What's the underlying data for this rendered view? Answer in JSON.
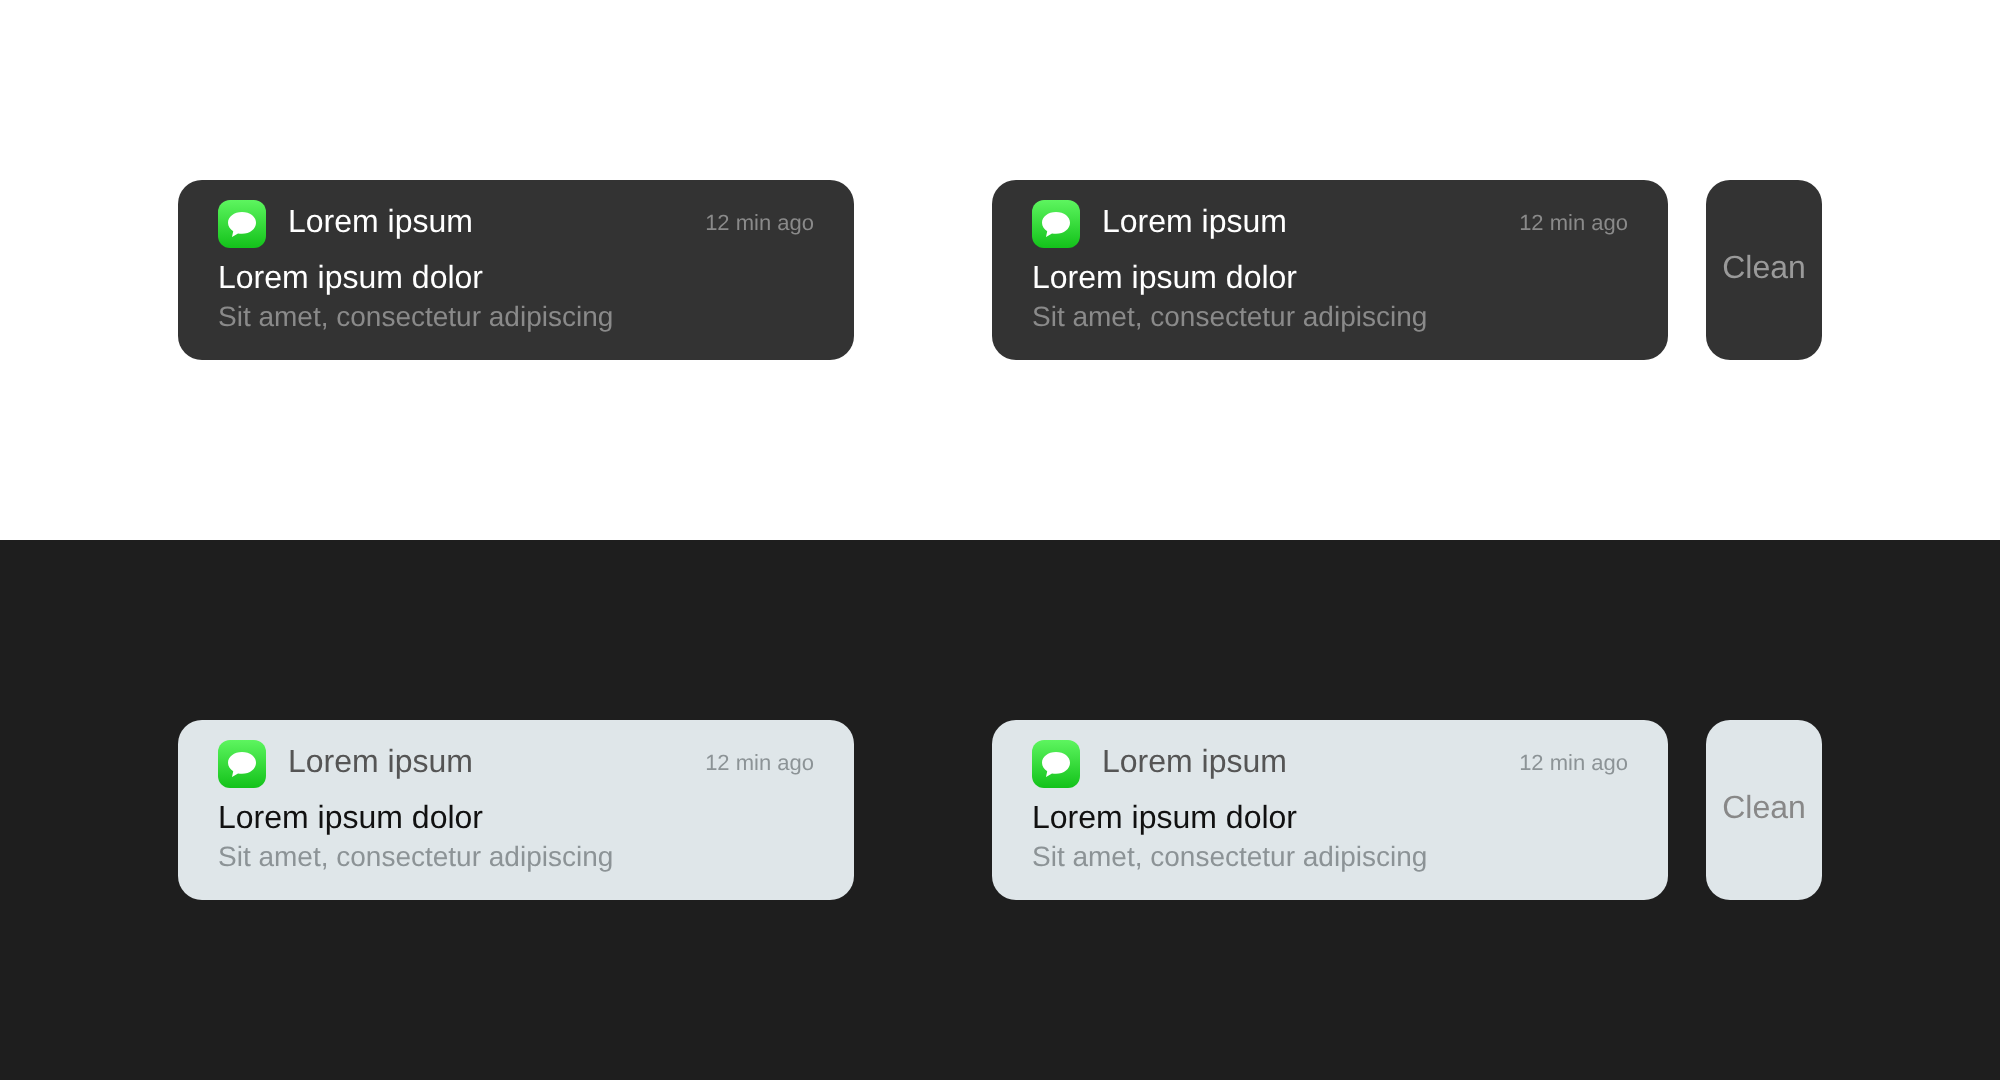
{
  "sections": [
    {
      "dark": false,
      "notifications": [
        {
          "app": "Lorem ipsum",
          "time": "12 min ago",
          "title": "Lorem ipsum dolor",
          "body": "Sit amet, consectetur adipiscing"
        },
        {
          "app": "Lorem ipsum",
          "time": "12 min ago",
          "title": "Lorem ipsum dolor",
          "body": "Sit amet, consectetur adipiscing"
        }
      ],
      "clean_button": "Clean"
    },
    {
      "dark": true,
      "notifications": [
        {
          "app": "Lorem ipsum",
          "time": "12 min ago",
          "title": "Lorem ipsum dolor",
          "body": "Sit amet, consectetur adipiscing"
        },
        {
          "app": "Lorem ipsum",
          "time": "12 min ago",
          "title": "Lorem ipsum dolor",
          "body": "Sit amet, consectetur adipiscing"
        }
      ],
      "clean_button": "Clean"
    }
  ]
}
